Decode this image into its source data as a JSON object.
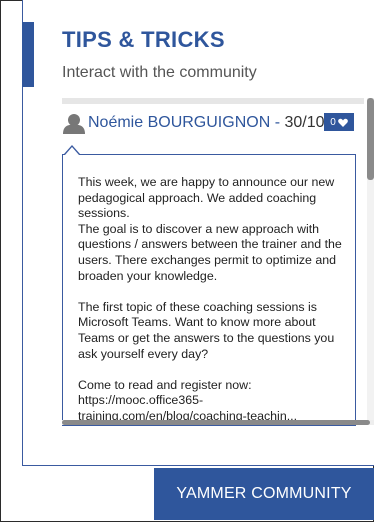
{
  "widget": {
    "title": "TIPS & TRICKS",
    "subtitle": "Interact with the community"
  },
  "post": {
    "avatar_icon": "user-avatar-icon",
    "author": "Noémie BOURGUIGNON",
    "separator": " - ",
    "date": "30/10",
    "like_count": "0",
    "like_icon": "heart-icon",
    "paragraphs": [
      "This week, we are happy to announce our new pedagogical approach. We added coaching sessions.\nThe goal is to discover a new approach with questions / answers between the trainer and the users. There exchanges permit to optimize and broaden your knowledge.",
      "The first topic of these coaching sessions is Microsoft Teams. Want to know more about Teams or get the answers to the questions you ask yourself every day?",
      "Come to read and register now: https://mooc.office365-training.com/en/blog/coaching-teachin..."
    ]
  },
  "footer": {
    "button_label": "YAMMER COMMUNITY"
  },
  "colors": {
    "accent": "#2f569c",
    "text": "#222222",
    "subtitle": "#555555"
  }
}
